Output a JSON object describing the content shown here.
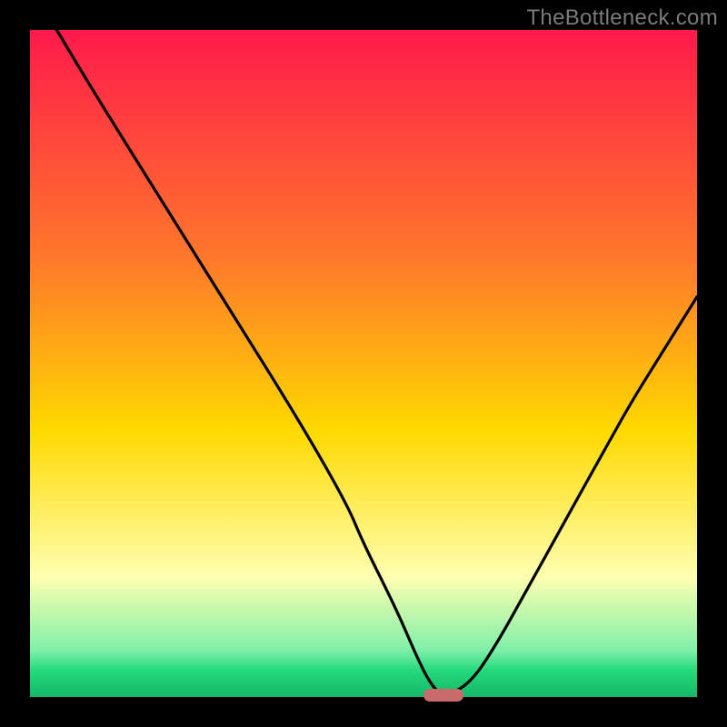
{
  "watermark": "TheBottleneck.com",
  "colors": {
    "top": "#ff1a4c",
    "mid1": "#ff7a2a",
    "mid2": "#ffd900",
    "pale": "#ffffb0",
    "green": "#24d97c",
    "dark_green": "#14b868",
    "frame": "#000000",
    "curve": "#000000",
    "marker_fill": "#c96b6b",
    "marker_stroke": "#c96b6b"
  },
  "chart_data": {
    "type": "line",
    "title": "",
    "xlabel": "",
    "ylabel": "",
    "xlim": [
      0,
      100
    ],
    "ylim": [
      0,
      100
    ],
    "grid": false,
    "legend": null,
    "series": [
      {
        "name": "bottleneck-curve",
        "x": [
          4,
          10,
          20,
          30,
          40,
          47.5,
          50,
          55,
          58,
          60,
          62,
          66,
          70,
          75,
          80,
          85,
          90,
          95,
          100
        ],
        "values": [
          100,
          90,
          74,
          58,
          42,
          29,
          23,
          13,
          6,
          2,
          0,
          2,
          8,
          17,
          26,
          35,
          44,
          52,
          60
        ]
      }
    ],
    "optimum_marker": {
      "x": 62,
      "y": 0,
      "width": 6
    },
    "notes": "x and y are approximate percentages read from the plot area (0–100). The curve descends steeply from upper-left, reaches ~0 near x≈62, then rises with a shallower slope toward the right edge reaching ~60 at x=100. A small horizontal pill marker sits on the baseline at the minimum. Background is a vertical red→orange→yellow→pale-yellow→green gradient inside a thick black frame."
  }
}
